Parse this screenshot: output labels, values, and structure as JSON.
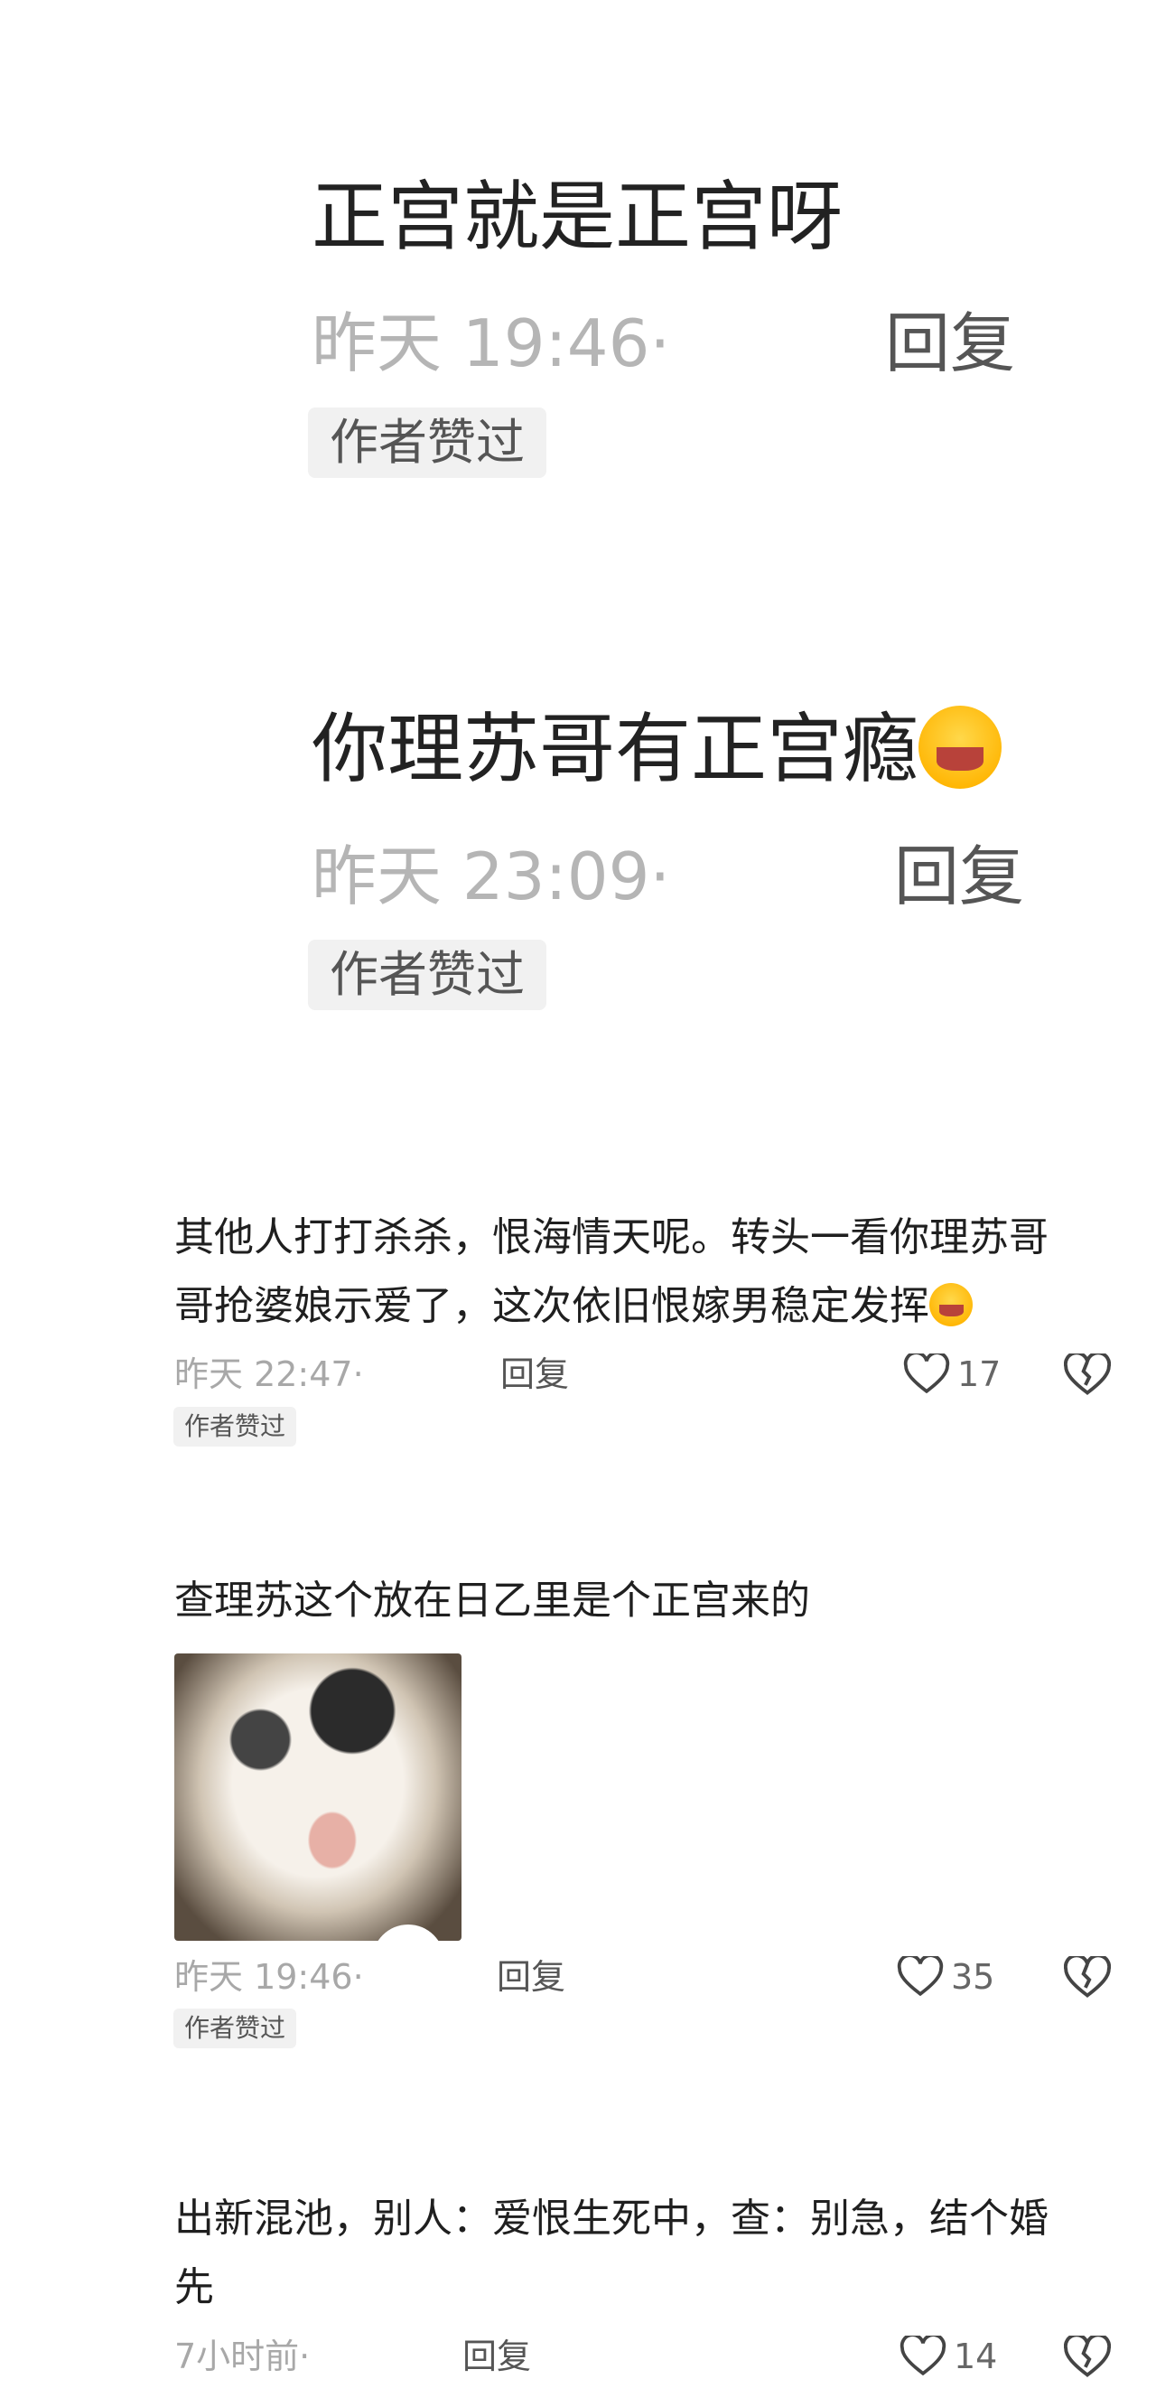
{
  "comments": [
    {
      "text": "正宫就是正宫呀",
      "time": "昨天 19:46·",
      "reply_label": "回复",
      "badge": "作者赞过"
    },
    {
      "text": "你理苏哥有正宫瘾",
      "emoji_icon": "laughing-crying-emoji-icon",
      "time": "昨天 23:09·",
      "reply_label": "回复",
      "badge": "作者赞过"
    },
    {
      "text_line1": "其他人打打杀杀，恨海情天呢。转头一看你理苏哥",
      "text_line2": "哥抢婆娘示爱了，这次依旧恨嫁男稳定发挥",
      "emoji_icon": "hugging-emoji-icon",
      "time": "昨天 22:47·",
      "reply_label": "回复",
      "like_count": "17",
      "badge": "作者赞过"
    },
    {
      "text": "查理苏这个放在日乙里是个正宫来的",
      "image": "dog-photo",
      "time": "昨天 19:46·",
      "reply_label": "回复",
      "like_count": "35",
      "badge": "作者赞过"
    },
    {
      "text_line1": "出新混池，别人：爱恨生死中，查：别急，结个婚",
      "text_line2": "先",
      "time": "7小时前·",
      "reply_label": "回复",
      "like_count": "14"
    }
  ],
  "colors": {
    "meta": "#a8a8a8",
    "badge_bg": "#f1f1f1",
    "text": "#1f1f1f"
  }
}
